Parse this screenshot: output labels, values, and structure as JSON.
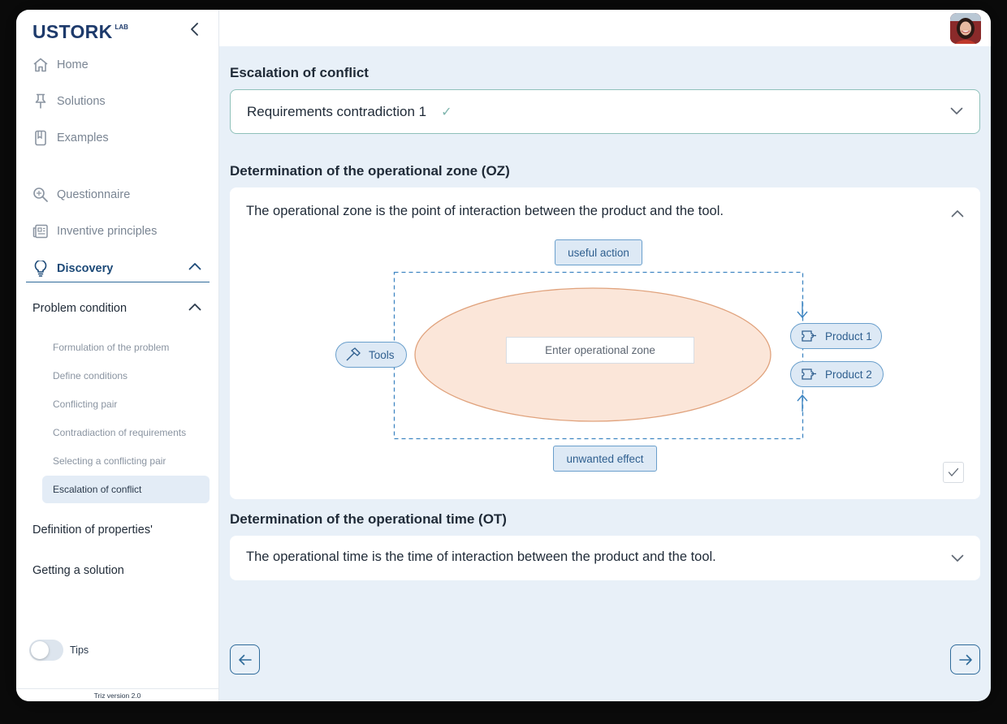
{
  "logo": {
    "main": "USTORK",
    "sup": "LAB"
  },
  "nav": {
    "home": "Home",
    "solutions": "Solutions",
    "examples": "Examples",
    "questionnaire": "Questionnaire",
    "inventive_principles": "Inventive principles",
    "discovery": "Discovery"
  },
  "problem_condition": {
    "label": "Problem condition",
    "items": [
      "Formulation of the problem",
      "Define conditions",
      "Conflicting pair",
      "Contradiaction of requirements",
      "Selecting a conflicting pair",
      "Escalation of conflict"
    ],
    "active_index": 5
  },
  "definition_of_properties": "Definition of properties'",
  "getting_a_solution": "Getting a solution",
  "tips": {
    "label": "Tips",
    "enabled": false
  },
  "version": "Triz version 2.0",
  "escalation": {
    "title": "Escalation of conflict",
    "selected": "Requirements contradiction 1",
    "check": "✓"
  },
  "oz": {
    "title": "Determination of the operational zone (OZ)",
    "description": "The operational zone is the point of interaction between the product and the tool.",
    "useful_action": "useful action",
    "unwanted_effect": "unwanted effect",
    "tools": "Tools",
    "product1": "Product 1",
    "product2": "Product 2",
    "input_placeholder": "Enter operational zone",
    "input_value": ""
  },
  "ot": {
    "title": "Determination of the operational time (OT)",
    "description": "The operational time is the time of interaction between the product and the tool."
  },
  "colors": {
    "brand": "#1d3a6b",
    "accent": "#2f6b9a",
    "background": "#e8f0f8",
    "zone_fill": "#fbe6d9",
    "zone_stroke": "#e0a27c"
  },
  "icons": {
    "home": "home-icon",
    "solutions": "pin-icon",
    "examples": "book-icon",
    "questionnaire": "search-icon",
    "inventive_principles": "newspaper-icon",
    "discovery": "lightbulb-icon"
  }
}
